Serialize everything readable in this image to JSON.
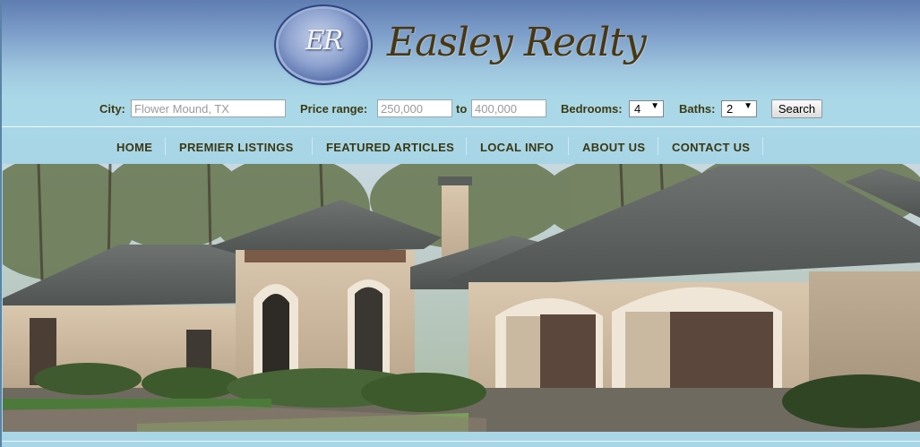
{
  "brand": {
    "logo_initials": "ER",
    "name": "Easley Realty"
  },
  "search": {
    "city_label": "City:",
    "city_placeholder": "Flower Mound, TX",
    "price_label": "Price range:",
    "price_min_placeholder": "250,000",
    "price_to": "to",
    "price_max_placeholder": "400,000",
    "bedrooms_label": "Bedrooms:",
    "bedrooms_value": "4",
    "baths_label": "Baths:",
    "baths_value": "2",
    "search_button": "Search"
  },
  "nav": {
    "items": [
      {
        "label": "HOME"
      },
      {
        "label": "PREMIER LISTINGS"
      },
      {
        "label": "FEATURED ARTICLES"
      },
      {
        "label": "LOCAL INFO"
      },
      {
        "label": "ABOUT US"
      },
      {
        "label": "CONTACT US"
      }
    ]
  },
  "colors": {
    "header_top": "#5f7db1",
    "header_bottom": "#abd9e8",
    "text_brown": "#3b3712",
    "brand_brown": "#4a3710"
  },
  "icons": {
    "select_arrow": "chevron-down-icon"
  }
}
